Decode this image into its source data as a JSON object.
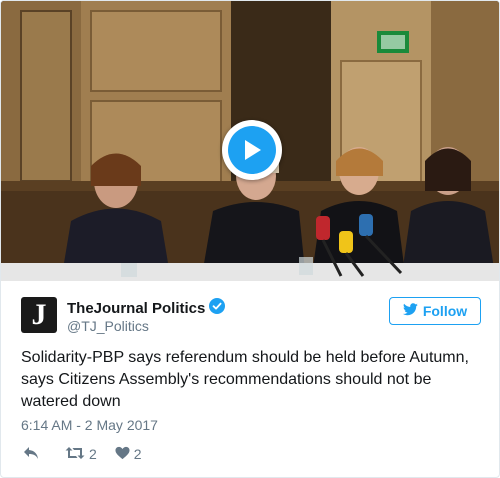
{
  "media": {
    "play_icon": "play-icon"
  },
  "author": {
    "avatar_letter": "J",
    "display_name": "TheJournal Politics",
    "handle": "@TJ_Politics",
    "verified_icon": "verified-badge-icon"
  },
  "follow": {
    "label": "Follow",
    "icon": "twitter-bird-icon"
  },
  "tweet": {
    "text": "Solidarity-PBP says referendum should be held before Autumn, says Citizens Assembly's recommendations should not be watered down",
    "timestamp": "6:14 AM - 2 May 2017"
  },
  "actions": {
    "reply_icon": "reply-icon",
    "retweet_count": "2",
    "like_count": "2"
  },
  "colors": {
    "accent": "#1da1f2",
    "muted": "#657786",
    "text": "#14171a"
  }
}
